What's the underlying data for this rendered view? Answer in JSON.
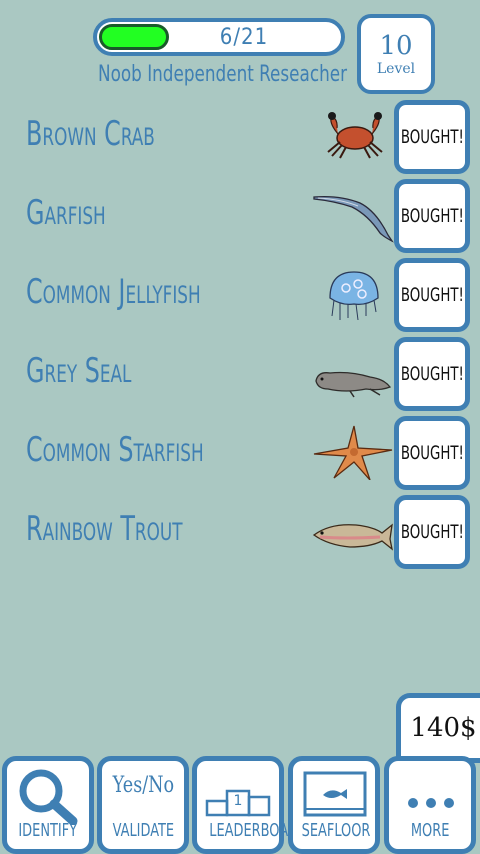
{
  "header": {
    "progress": {
      "current": 6,
      "total": 21,
      "text": "6/21",
      "fraction": 0.286
    },
    "rank": "Noob Independent Reseacher",
    "level": {
      "number": "10",
      "label": "Level"
    }
  },
  "species": [
    {
      "name": "Brown Crab",
      "icon": "crab-icon",
      "button": "BOUGHT!"
    },
    {
      "name": "Garfish",
      "icon": "garfish-icon",
      "button": "BOUGHT!"
    },
    {
      "name": "Common Jellyfish",
      "icon": "jellyfish-icon",
      "button": "BOUGHT!"
    },
    {
      "name": "Grey Seal",
      "icon": "seal-icon",
      "button": "BOUGHT!"
    },
    {
      "name": "Common Starfish",
      "icon": "starfish-icon",
      "button": "BOUGHT!"
    },
    {
      "name": "Rainbow Trout",
      "icon": "trout-icon",
      "button": "BOUGHT!"
    }
  ],
  "money": "140$",
  "nav": {
    "identify": "IDENTIFY",
    "validate": "VALIDATE",
    "validate_icon_text": "Yes/No",
    "leaderboard": "LEADERBOARD",
    "leaderboard_icon_text": "1",
    "seafloor": "SEAFLOOR",
    "more": "MORE"
  },
  "colors": {
    "background": "#aac8c2",
    "accent": "#3f7fb3",
    "progress_fill": "#22ff22"
  }
}
